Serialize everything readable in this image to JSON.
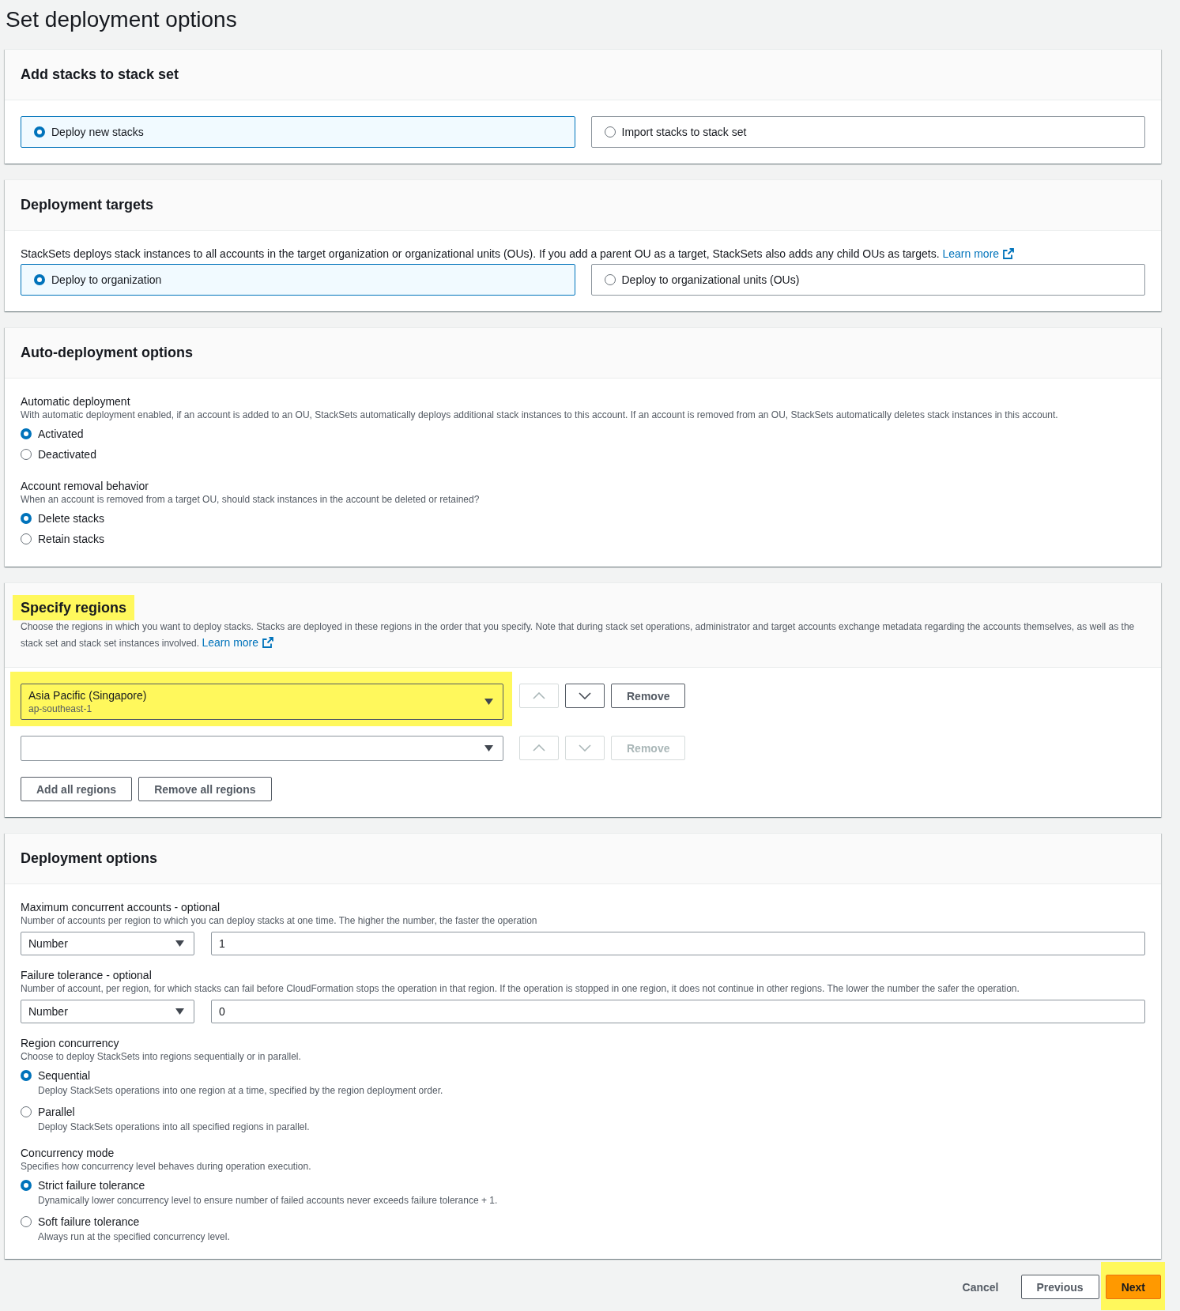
{
  "page": {
    "title": "Set deployment options"
  },
  "sections": [
    {
      "title": "Add stacks to stack set",
      "highlighted": false,
      "blocks": [
        {
          "kind": "tiles",
          "options": [
            {
              "label": "Deploy new stacks",
              "selected": true
            },
            {
              "label": "Import stacks to stack set",
              "selected": false
            }
          ]
        }
      ]
    },
    {
      "title": "Deployment targets",
      "highlighted": false,
      "blocks": [
        {
          "kind": "note",
          "text": "StackSets deploys stack instances to all accounts in the target organization or organizational units (OUs). If you add a parent OU as a target, StackSets also adds any child OUs as targets.",
          "link": "Learn more"
        },
        {
          "kind": "tiles",
          "options": [
            {
              "label": "Deploy to organization",
              "selected": true
            },
            {
              "label": "Deploy to organizational units (OUs)",
              "selected": false
            }
          ]
        }
      ]
    },
    {
      "title": "Auto-deployment options",
      "highlighted": false,
      "blocks": [
        {
          "kind": "radio_group",
          "label": "Automatic deployment",
          "description": "With automatic deployment enabled, if an account is added to an OU, StackSets automatically deploys additional stack instances to this account. If an account is removed from an OU, StackSets automatically deletes stack instances in this account.",
          "options": [
            {
              "label": "Activated",
              "selected": true
            },
            {
              "label": "Deactivated",
              "selected": false
            }
          ]
        },
        {
          "kind": "radio_group",
          "label": "Account removal behavior",
          "description": "When an account is removed from a target OU, should stack instances in the account be deleted or retained?",
          "options": [
            {
              "label": "Delete stacks",
              "selected": true
            },
            {
              "label": "Retain stacks",
              "selected": false
            }
          ]
        }
      ]
    },
    {
      "title": "Specify regions",
      "highlighted": true,
      "description": "Choose the regions in which you want to deploy stacks. Stacks are deployed in these regions in the order that you specify. Note that during stack set operations, administrator and target accounts exchange metadata regarding the accounts themselves, as well as the stack set and stack set instances involved.",
      "link": "Learn more",
      "blocks": [
        {
          "kind": "region_list",
          "rows": [
            {
              "region": "Asia Pacific (Singapore)",
              "code": "ap-southeast-1",
              "highlighted": true,
              "up_disabled": true,
              "down_disabled": false,
              "remove_label": "Remove",
              "remove_disabled": false
            },
            {
              "highlighted": false,
              "up_disabled": true,
              "down_disabled": true,
              "remove_label": "Remove",
              "remove_disabled": true
            }
          ],
          "buttons": [
            "Add all regions",
            "Remove all regions"
          ]
        }
      ]
    },
    {
      "title": "Deployment options",
      "highlighted": false,
      "blocks": [
        {
          "kind": "select_input",
          "label": "Maximum concurrent accounts - optional",
          "description": "Number of accounts per region to which you can deploy stacks at one time. The higher the number, the faster the operation",
          "select": "Number",
          "value": "1"
        },
        {
          "kind": "select_input",
          "label": "Failure tolerance - optional",
          "description": "Number of account, per region, for which stacks can fail before CloudFormation stops the operation in that region. If the operation is stopped in one region, it does not continue in other regions. The lower the number the safer the operation.",
          "select": "Number",
          "value": "0"
        },
        {
          "kind": "radio_group",
          "label": "Region concurrency",
          "description": "Choose to deploy StackSets into regions sequentially or in parallel.",
          "options": [
            {
              "label": "Sequential",
              "description": "Deploy StackSets operations into one region at a time, specified by the region deployment order.",
              "selected": true
            },
            {
              "label": "Parallel",
              "description": "Deploy StackSets operations into all specified regions in parallel.",
              "selected": false
            }
          ]
        },
        {
          "kind": "radio_group",
          "label": "Concurrency mode",
          "description": "Specifies how concurrency level behaves during operation execution.",
          "options": [
            {
              "label": "Strict failure tolerance",
              "description": "Dynamically lower concurrency level to ensure number of failed accounts never exceeds failure tolerance + 1.",
              "selected": true
            },
            {
              "label": "Soft failure tolerance",
              "description": "Always run at the specified concurrency level.",
              "selected": false
            }
          ]
        }
      ]
    }
  ],
  "footer": {
    "buttons": [
      {
        "label": "Cancel",
        "kind": "link",
        "highlighted": false
      },
      {
        "label": "Previous",
        "kind": "secondary",
        "highlighted": false
      },
      {
        "label": "Next",
        "kind": "primary",
        "highlighted": true
      }
    ]
  }
}
